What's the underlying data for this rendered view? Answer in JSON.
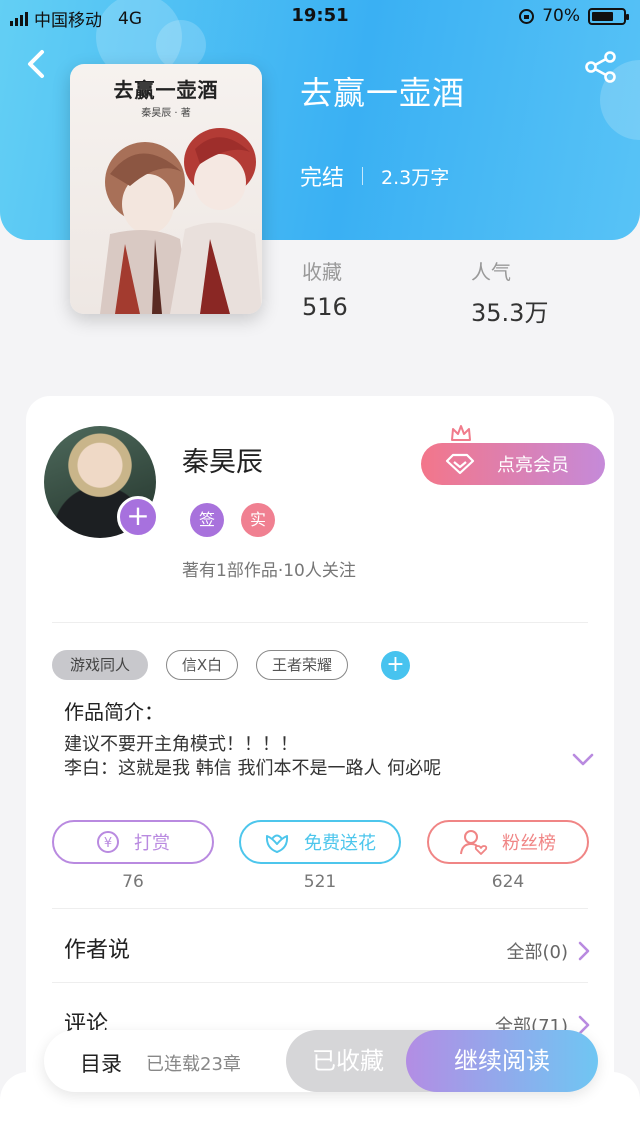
{
  "status_bar": {
    "carrier": "中国移动",
    "network": "4G",
    "time": "19:51",
    "battery": "70%",
    "battery_level": 0.7
  },
  "book": {
    "title": "去赢一壶酒",
    "state": "完结",
    "words": "2.3万字",
    "cover_title": "去赢一壶酒",
    "cover_author": "秦昊辰 · 著",
    "stats": [
      {
        "label": "收藏",
        "value": "516"
      },
      {
        "label": "人气",
        "value": "35.3万"
      }
    ]
  },
  "author": {
    "name": "秦昊辰",
    "badges": [
      {
        "text": "签",
        "color": "#a872dc"
      },
      {
        "text": "实",
        "color": "#f08091"
      }
    ],
    "info": "著有1部作品·10人关注",
    "vip_label": "点亮会员"
  },
  "tags": [
    "游戏同人",
    "信X白",
    "王者荣耀"
  ],
  "intro": {
    "label": "作品简介：",
    "lines": [
      "建议不要开主角模式！！！！",
      "李白：这就是我 韩信 我们本不是一路人 何必呢"
    ]
  },
  "actions": [
    {
      "label": "打赏",
      "count": "76",
      "color": "#b98ae0"
    },
    {
      "label": "免费送花",
      "count": "521",
      "color": "#4dc6ec"
    },
    {
      "label": "粉丝榜",
      "count": "624",
      "color": "#f08585"
    }
  ],
  "author_says": {
    "title": "作者说",
    "link": "全部(0)"
  },
  "comments": {
    "title": "评论",
    "link": "全部(71)"
  },
  "bottom": {
    "toc": "目录",
    "serial": "已连载23章",
    "collected": "已收藏",
    "continue": "继续阅读"
  },
  "colors": {
    "accent_blue": "#3ab0f3",
    "accent_purple": "#a771de"
  }
}
